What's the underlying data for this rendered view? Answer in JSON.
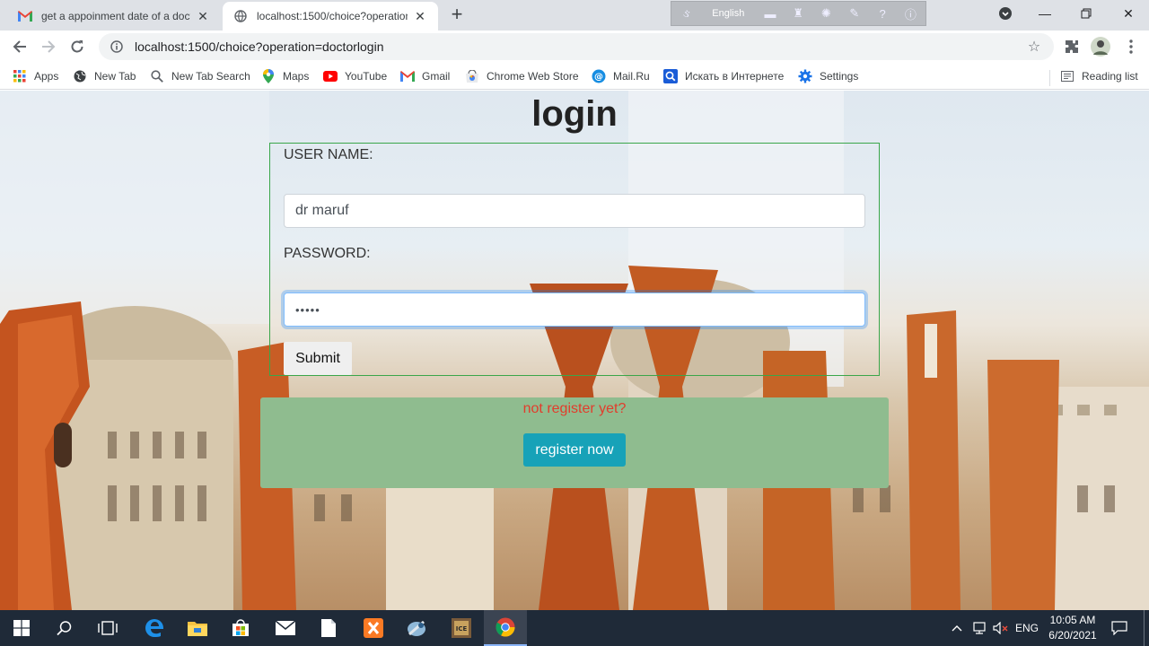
{
  "tabs": [
    {
      "title": "get a appoinment date of a docto",
      "icon": "gmail-icon",
      "active": false
    },
    {
      "title": "localhost:1500/choice?operation",
      "icon": "globe-icon",
      "active": true
    }
  ],
  "language_bar": {
    "language": "English"
  },
  "toolbar": {
    "url": "localhost:1500/choice?operation=doctorlogin"
  },
  "bookmarks": [
    {
      "label": "Apps",
      "icon": "apps-grid-icon"
    },
    {
      "label": "New Tab",
      "icon": "globe-icon"
    },
    {
      "label": "New Tab Search",
      "icon": "search-icon"
    },
    {
      "label": "Maps",
      "icon": "maps-icon"
    },
    {
      "label": "YouTube",
      "icon": "youtube-icon"
    },
    {
      "label": "Gmail",
      "icon": "gmail-icon"
    },
    {
      "label": "Chrome Web Store",
      "icon": "webstore-icon"
    },
    {
      "label": "Mail.Ru",
      "icon": "mailru-icon"
    },
    {
      "label": "Искать в Интернете",
      "icon": "search-icon"
    },
    {
      "label": "Settings",
      "icon": "gear-icon"
    }
  ],
  "reading_list": "Reading list",
  "page": {
    "heading": "login",
    "username_label": "USER NAME:",
    "username_value": "dr maruf",
    "password_label": "PASSWORD:",
    "password_value": "•••••",
    "submit_label": "Submit",
    "not_registered": "not register yet?",
    "register_label": "register now"
  },
  "taskbar": {
    "language": "ENG",
    "time": "10:05 AM",
    "date": "6/20/2021"
  },
  "colors": {
    "register_panel": "#8fbc8f",
    "register_button": "#17a2b8",
    "warning_text": "#e23c2c",
    "login_border": "#3aa64a"
  }
}
